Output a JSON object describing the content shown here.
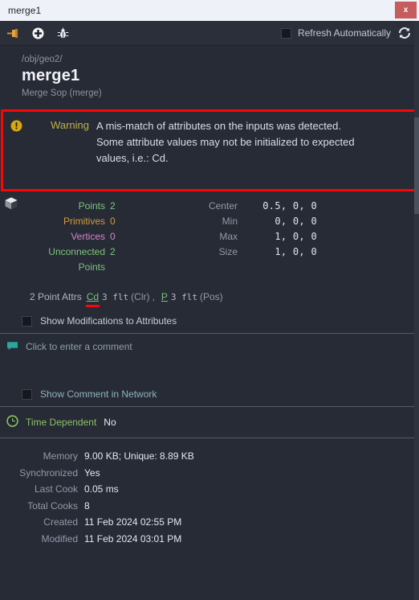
{
  "window": {
    "title": "merge1",
    "close_label": "x"
  },
  "toolbar": {
    "icons": [
      {
        "name": "pin-icon",
        "label": "Pin"
      },
      {
        "name": "add-icon",
        "label": "Add"
      },
      {
        "name": "bug-icon",
        "label": "Debug"
      }
    ],
    "refresh_checkbox_checked": false,
    "refresh_label": "Refresh Automatically",
    "refresh_icon": "refresh-icon"
  },
  "node": {
    "path": "/obj/geo2/",
    "name": "merge1",
    "type": "Merge Sop (merge)"
  },
  "warning": {
    "icon": "warning-icon",
    "label": "Warning",
    "text": "A mis-match of attributes on the inputs was detected. Some attribute values may not be initialized to expected values, i.e.: Cd.",
    "border_color": "#fb0606"
  },
  "geometry": {
    "icon": "cube-icon",
    "left_stats": [
      {
        "label": "Points",
        "value": "2",
        "color": "#7cc47c"
      },
      {
        "label": "Primitives",
        "value": "0",
        "color": "#d39b3a"
      },
      {
        "label": "Vertices",
        "value": "0",
        "color": "#cf86c4"
      },
      {
        "label": "Unconnected Points",
        "value": "2",
        "color": "#7cc47c"
      }
    ],
    "right_stats": [
      {
        "label": "Center",
        "value": "0.5, 0, 0"
      },
      {
        "label": "Min",
        "value": "0, 0, 0"
      },
      {
        "label": "Max",
        "value": "1, 0, 0"
      },
      {
        "label": "Size",
        "value": "1, 0, 0"
      }
    ]
  },
  "point_attrs": {
    "count_label": "2 Point Attrs",
    "items": [
      {
        "name": "Cd",
        "meta": "3 flt",
        "kind": "(Clr)",
        "error": true
      },
      {
        "name": "P",
        "meta": "3 flt",
        "kind": "(Pos)",
        "error": false
      }
    ],
    "separator": ","
  },
  "show_modifications": {
    "checked": false,
    "label": "Show Modifications to Attributes"
  },
  "comment": {
    "icon": "comment-icon",
    "placeholder": "Click to enter a comment"
  },
  "show_comment_network": {
    "checked": false,
    "label": "Show Comment in Network"
  },
  "time_dependent": {
    "icon": "clock-icon",
    "label": "Time Dependent",
    "value": "No"
  },
  "info": {
    "rows": [
      {
        "label": "Memory",
        "value": "9.00 KB; Unique: 8.89 KB"
      },
      {
        "label": "Synchronized",
        "value": "Yes"
      },
      {
        "label": "Last Cook",
        "value": "0.05 ms"
      },
      {
        "label": "Total Cooks",
        "value": "8"
      },
      {
        "label": "Created",
        "value": "11 Feb 2024 02:55 PM"
      },
      {
        "label": "Modified",
        "value": "11 Feb 2024 03:01 PM"
      }
    ]
  }
}
